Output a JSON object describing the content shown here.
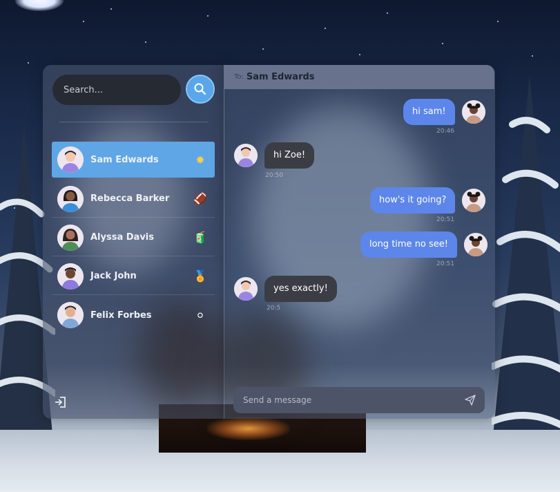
{
  "search": {
    "placeholder": "Search..."
  },
  "contacts": [
    {
      "name": "Sam Edwards",
      "emoji": "✸",
      "active": true
    },
    {
      "name": "Rebecca Barker",
      "emoji": "🏈",
      "active": false
    },
    {
      "name": "Alyssa Davis",
      "emoji": "🧃",
      "active": false
    },
    {
      "name": "Jack John",
      "emoji": "🏅",
      "active": false
    },
    {
      "name": "Felix Forbes",
      "emoji": "⚪",
      "active": false
    }
  ],
  "chat": {
    "to_label": "To:",
    "recipient": "Sam Edwards",
    "messages": [
      {
        "direction": "out",
        "text": "hi sam!",
        "time": "20:46"
      },
      {
        "direction": "in",
        "text": "hi Zoe!",
        "time": "20:50"
      },
      {
        "direction": "out",
        "text": "how's it going?",
        "time": "20:51"
      },
      {
        "direction": "out",
        "text": "long time no see!",
        "time": "20:51"
      },
      {
        "direction": "in",
        "text": "yes exactly!",
        "time": "20:5"
      }
    ],
    "composer_placeholder": "Send a message"
  },
  "colors": {
    "accent": "#5fa6e6",
    "outgoing_bubble": "#5c86ea",
    "incoming_bubble": "#3b3d44"
  },
  "icons": {
    "search": "search-icon",
    "send": "send-icon",
    "logout": "logout-icon"
  }
}
